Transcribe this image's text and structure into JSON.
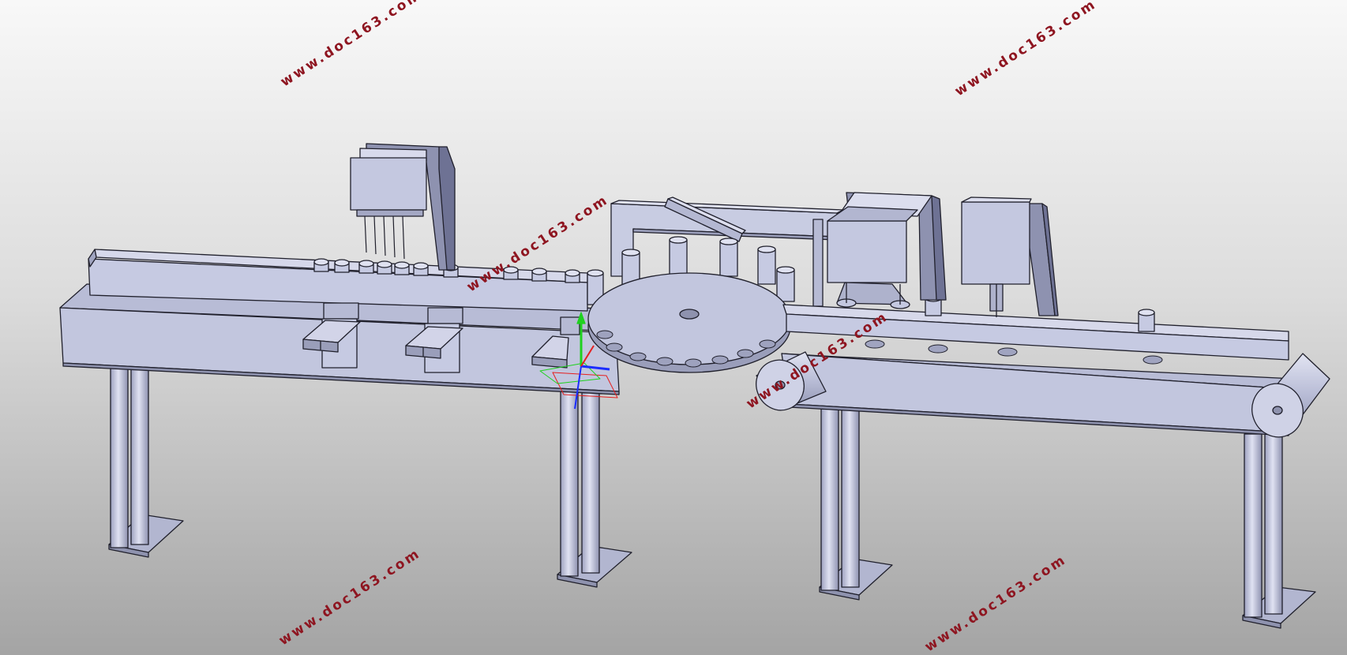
{
  "viewport": {
    "background_top": "#f8f8f8",
    "background_bottom": "#a4a4a4"
  },
  "model": {
    "part_color": "#c4c8e0",
    "part_shade": "#a4a8c4",
    "edge_color": "#20202c",
    "triad_colors": {
      "x": "#1a2cff",
      "y": "#1fd11f",
      "z": "#e52020"
    }
  },
  "watermarks": [
    "www.doc163.com",
    "www.doc163.com",
    "www.doc163.com",
    "www.doc163.com",
    "www.doc163.com",
    "www.doc163.com"
  ]
}
